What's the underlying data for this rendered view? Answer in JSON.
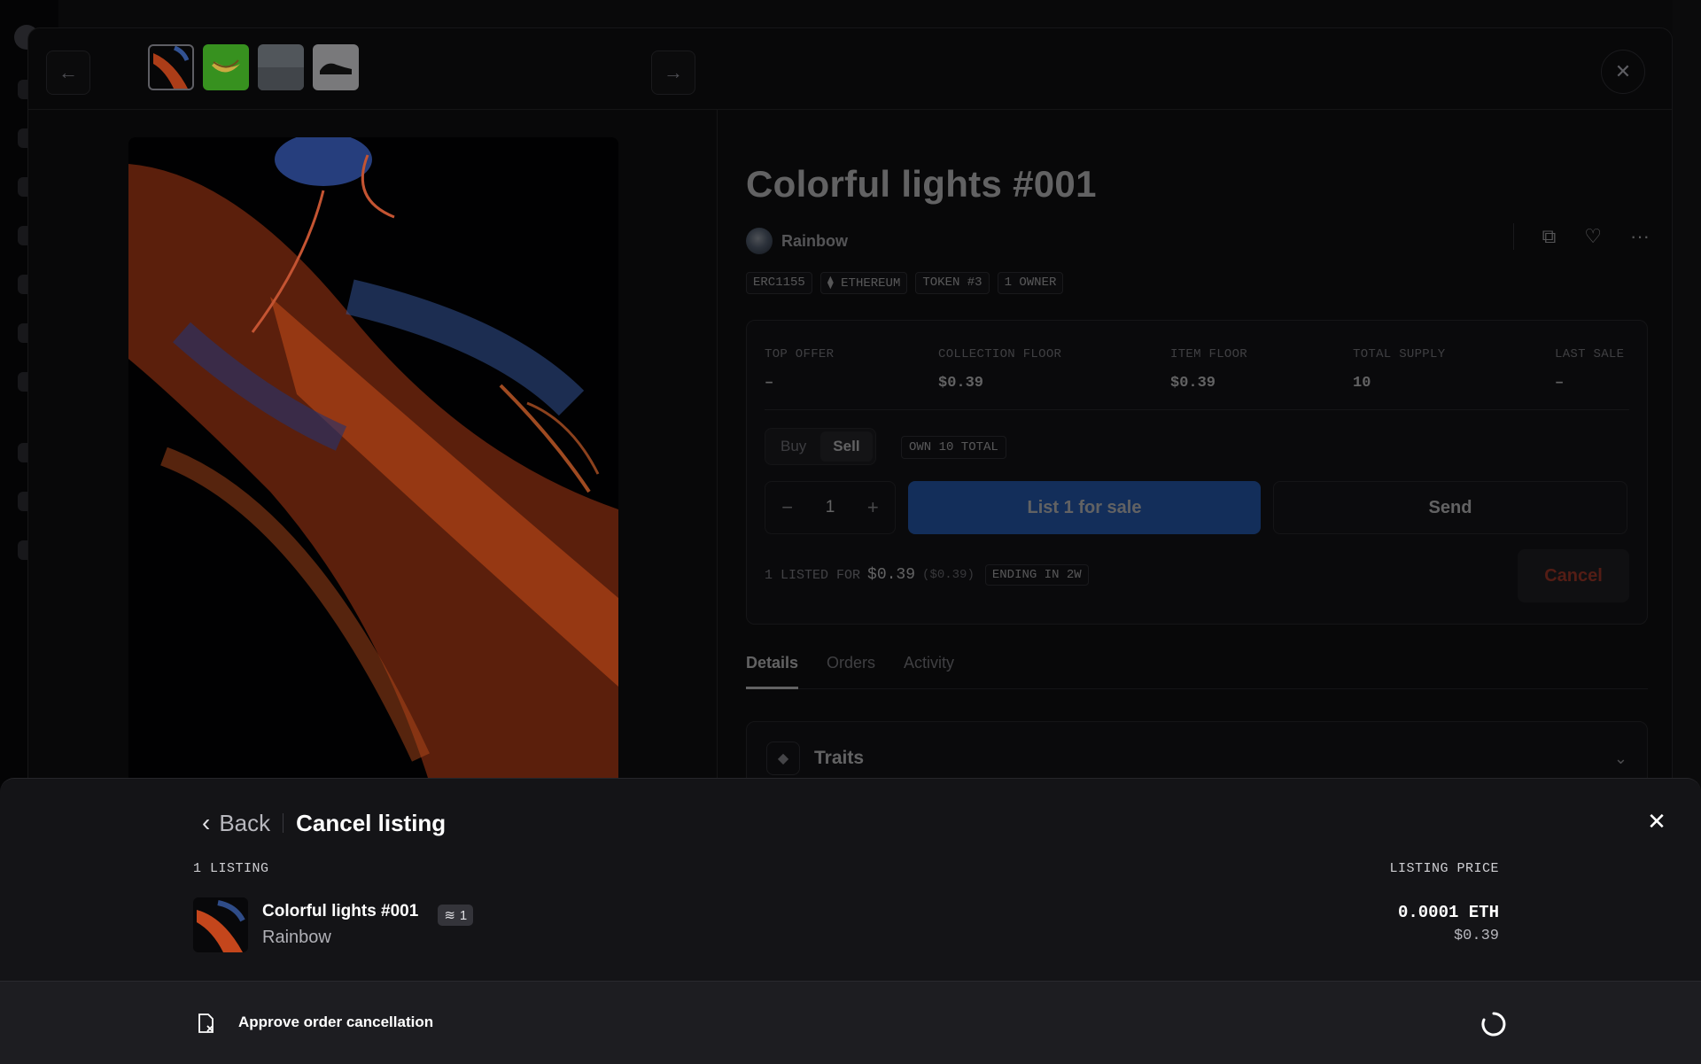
{
  "nav": {
    "prev_icon": "arrow-left-icon",
    "next_icon": "arrow-right-icon",
    "close_icon": "close-icon"
  },
  "item": {
    "title": "Colorful lights #001",
    "creator": "Rainbow",
    "tags": [
      "ERC1155",
      "ETHEREUM",
      "TOKEN #3",
      "1 OWNER"
    ]
  },
  "stats": [
    {
      "label": "TOP OFFER",
      "value": "–"
    },
    {
      "label": "COLLECTION FLOOR",
      "value": "$0.39"
    },
    {
      "label": "ITEM FLOOR",
      "value": "$0.39"
    },
    {
      "label": "TOTAL SUPPLY",
      "value": "10"
    },
    {
      "label": "LAST SALE",
      "value": "–"
    }
  ],
  "trade": {
    "buy_label": "Buy",
    "sell_label": "Sell",
    "own_badge": "OWN 10 TOTAL",
    "quantity": "1",
    "minus": "−",
    "plus": "+",
    "list_button": "List 1 for sale",
    "send_button": "Send",
    "listed_prefix": "1 LISTED FOR",
    "listed_price": "$0.39",
    "listed_usd": "($0.39)",
    "ending": "ENDING IN 2W",
    "cancel_button": "Cancel"
  },
  "tabs": [
    "Details",
    "Orders",
    "Activity"
  ],
  "traits_label": "Traits",
  "sheet": {
    "back_label": "Back",
    "title": "Cancel listing",
    "count_label": "1 LISTING",
    "price_header": "LISTING PRICE",
    "listing": {
      "name": "Colorful lights #001",
      "collection": "Rainbow",
      "quantity": "1",
      "price_eth": "0.0001 ETH",
      "price_usd": "$0.39"
    },
    "approve_label": "Approve order cancellation"
  },
  "colors": {
    "accent": "#2a74e8",
    "danger": "#d8442c",
    "sheet_bg": "#141417"
  }
}
